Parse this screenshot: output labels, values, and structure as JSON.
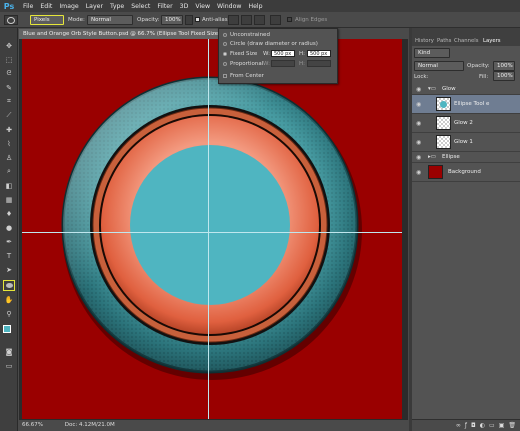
{
  "app": {
    "logo": "Ps"
  },
  "menu": [
    "File",
    "Edit",
    "Image",
    "Layer",
    "Type",
    "Select",
    "Filter",
    "3D",
    "View",
    "Window",
    "Help"
  ],
  "options": {
    "units_value": "Pixels",
    "mode_label": "Mode:",
    "mode_value": "Normal",
    "opacity_label": "Opacity:",
    "opacity_value": "100%",
    "antialias_label": "Anti-alias",
    "align_edges_label": "Align Edges"
  },
  "popup": {
    "unconstrained": "Unconstrained",
    "circle": "Circle (draw diameter or radius)",
    "fixed_size": "Fixed Size",
    "w_label": "W:",
    "w_value": "500 px",
    "h_label": "H:",
    "h_value": "500 px",
    "proportional": "Proportional",
    "prop_w": "W:",
    "prop_h": "H:",
    "from_center": "From Center"
  },
  "document": {
    "tab_title": "Blue and Orange Orb Style Button.psd @ 66.7% (Ellipse Tool Fixed Size"
  },
  "status": {
    "zoom": "66.67%",
    "doc": "Doc: 4.12M/21.0M"
  },
  "color_label": "#4fb5c1",
  "colors": {
    "background": "#9a0000",
    "center": "#4fb5c1",
    "orange_ring": "#e8684a",
    "teal_ring": "#2c7a80",
    "highlight_tool": "#e6e63a"
  },
  "panel": {
    "tabs": [
      "History",
      "Paths",
      "Channels",
      "Layers"
    ],
    "kind_label": "Kind",
    "blend_mode": "Normal",
    "opacity_label": "Opacity:",
    "opacity_value": "100%",
    "lock_label": "Lock:",
    "fill_label": "Fill:",
    "fill_value": "100%",
    "layers": [
      {
        "name": "Glow",
        "type": "group"
      },
      {
        "name": "Ellipse Tool e",
        "type": "layer",
        "selected": true
      },
      {
        "name": "Glow 2",
        "type": "layer"
      },
      {
        "name": "Glow 1",
        "type": "layer"
      },
      {
        "name": "Ellipse",
        "type": "group"
      },
      {
        "name": "Background",
        "type": "layer"
      }
    ]
  },
  "tool_icons": [
    "move-icon",
    "marquee-icon",
    "lasso-icon",
    "quick-select-icon",
    "crop-icon",
    "eyedropper-icon",
    "healing-icon",
    "brush-icon",
    "clone-stamp-icon",
    "history-brush-icon",
    "eraser-icon",
    "gradient-icon",
    "blur-icon",
    "dodge-icon",
    "pen-icon",
    "type-icon",
    "path-select-icon",
    "ellipse-icon",
    "hand-icon",
    "zoom-icon"
  ]
}
